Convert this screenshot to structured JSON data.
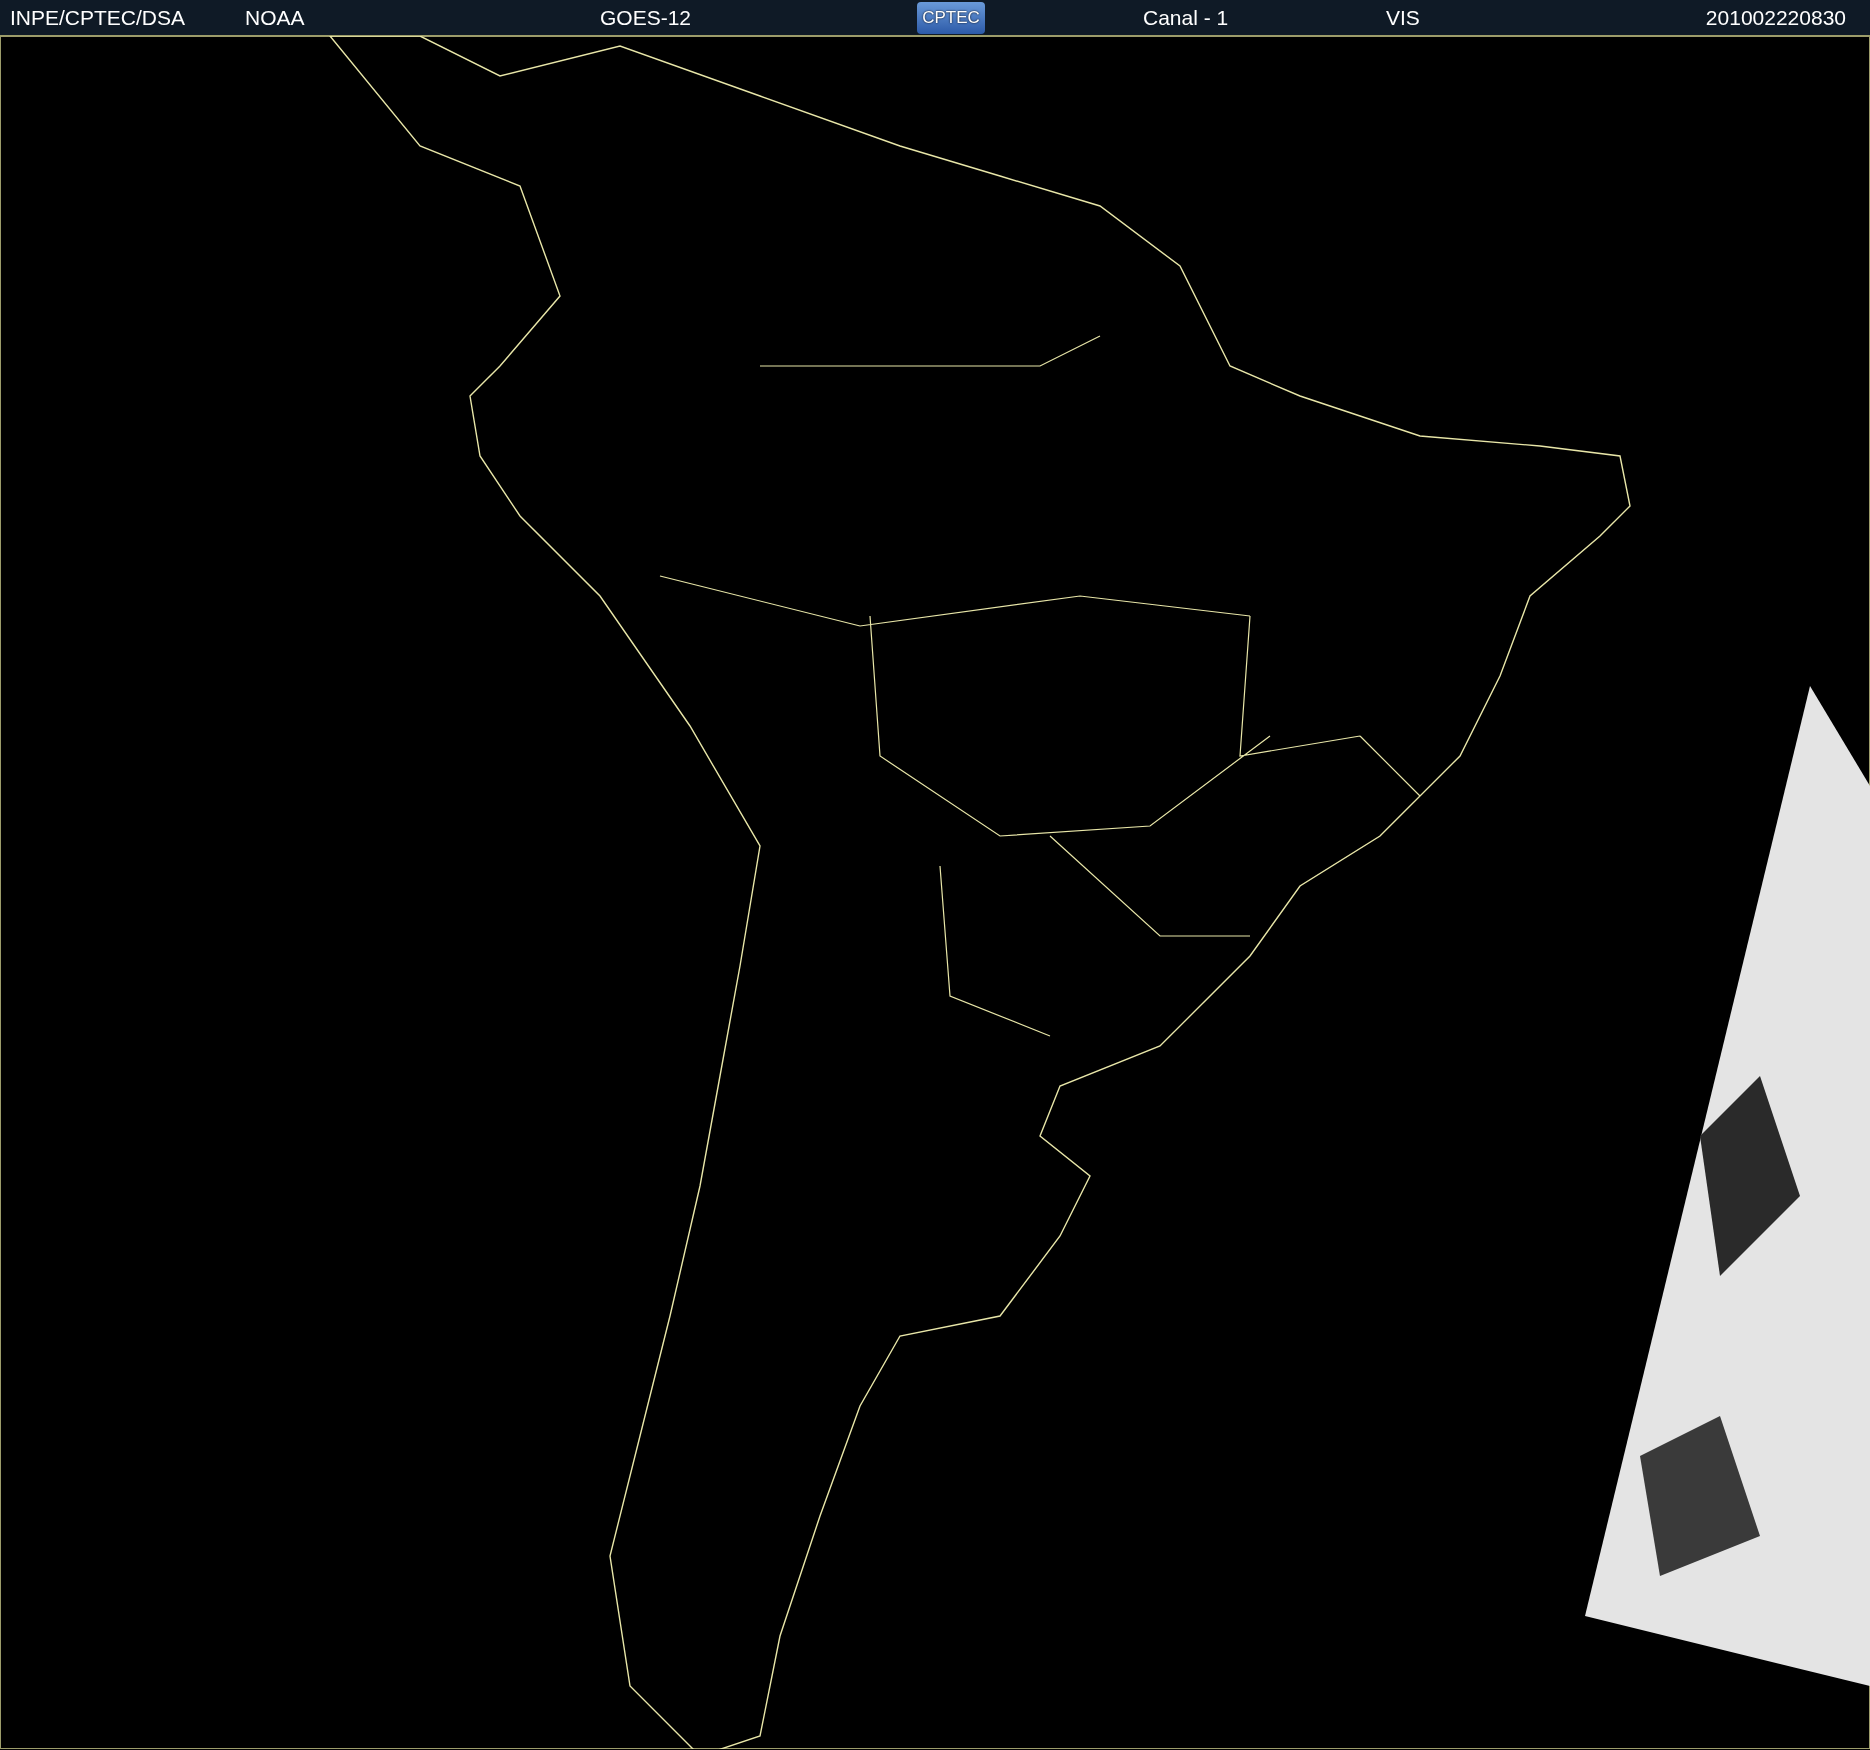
{
  "header": {
    "source": "INPE/CPTEC/DSA",
    "agency": "NOAA",
    "satellite": "GOES-12",
    "logo": "CPTEC",
    "channel": "Canal - 1",
    "band": "VIS",
    "timestamp": "201002220830"
  }
}
